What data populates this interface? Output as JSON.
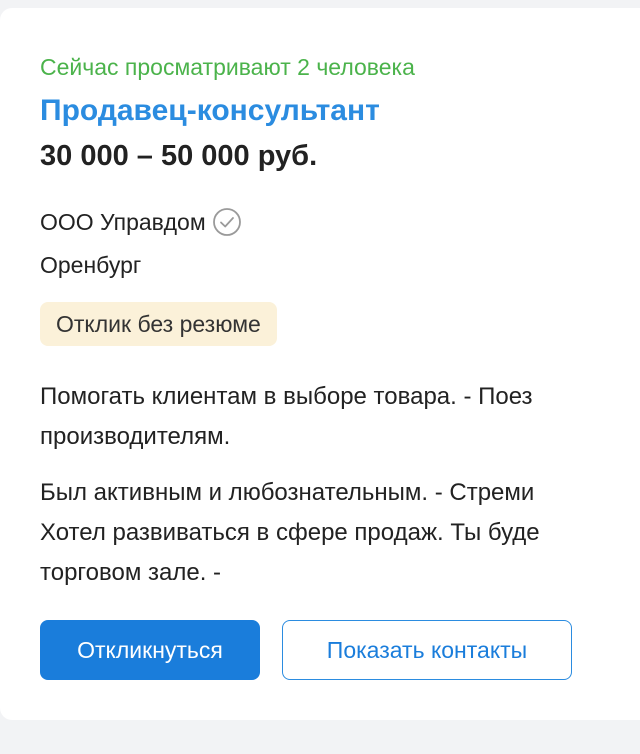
{
  "vacancy": {
    "viewers_text": "Сейчас просматривают 2 человека",
    "title": "Продавец-консультант",
    "salary": "30 000 – 50 000 руб.",
    "company": "ООО Управдом",
    "company_verified_icon": "verified-check-icon",
    "city": "Оренбург",
    "badge": "Отклик без резюме",
    "description_lines": [
      "Помогать клиентам в выборе товара. - Поез",
      "производителям.",
      "Был активным и любознательным. - Стреми",
      "Хотел развиваться в сфере продаж. Ты буде",
      "торговом зале. -"
    ]
  },
  "actions": {
    "apply_label": "Откликнуться",
    "show_contacts_label": "Показать контакты"
  },
  "colors": {
    "viewers": "#4bb34b",
    "title": "#2b8ce0",
    "primary_button": "#1a7ddb",
    "badge_bg": "#fbf1d9"
  }
}
